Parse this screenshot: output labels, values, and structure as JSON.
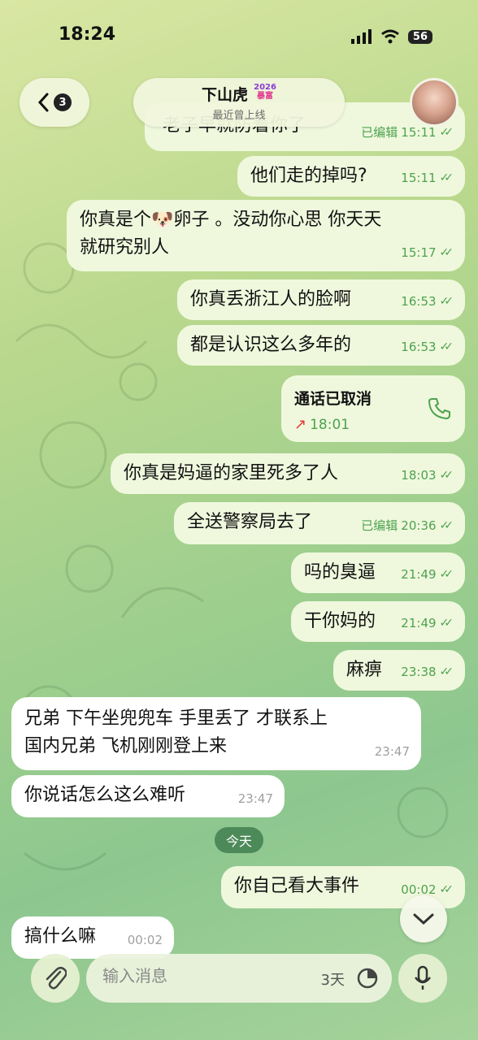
{
  "status_bar": {
    "time": "18:24",
    "battery": "56"
  },
  "header": {
    "unread_count": "3",
    "chat_name": "下山虎",
    "name_tag_line1": "2026",
    "name_tag_line2": "暴富",
    "last_seen": "最近曾上线"
  },
  "messages": [
    {
      "text": "老子早就防着你了",
      "time": "15:11",
      "edited": "已编辑",
      "dir": "out"
    },
    {
      "text": "他们走的掉吗?",
      "time": "15:11",
      "dir": "out"
    },
    {
      "line1_a": "你真是个",
      "emoji": "🐶",
      "line1_b": "卵子 。没动你心思 你天天",
      "line2": "就研究别人",
      "time": "15:17",
      "dir": "out"
    },
    {
      "text": "你真丢浙江人的脸啊",
      "time": "16:53",
      "dir": "out"
    },
    {
      "text": "都是认识这么多年的",
      "time": "16:53",
      "dir": "out"
    },
    {
      "call_title": "通话已取消",
      "call_time": "18:01",
      "dir": "out"
    },
    {
      "text": "你真是妈逼的家里死多了人",
      "time": "18:03",
      "dir": "out"
    },
    {
      "text": "全送警察局去了",
      "time": "20:36",
      "edited": "已编辑",
      "dir": "out"
    },
    {
      "text": "吗的臭逼",
      "time": "21:49",
      "dir": "out"
    },
    {
      "text": "干你妈的",
      "time": "21:49",
      "dir": "out"
    },
    {
      "text": "麻痹",
      "time": "23:38",
      "dir": "out"
    },
    {
      "line1": "兄弟  下午坐兜兜车 手里丢了 才联系上",
      "line2": "国内兄弟  飞机刚刚登上来",
      "time": "23:47",
      "dir": "in"
    },
    {
      "text": "你说话怎么这么难听",
      "time": "23:47",
      "dir": "in"
    },
    {
      "text": "你自己看大事件",
      "time": "00:02",
      "dir": "out"
    },
    {
      "text": "搞什么嘛",
      "time": "00:02",
      "dir": "in"
    }
  ],
  "date_divider": "今天",
  "input": {
    "placeholder": "输入消息",
    "timer": "3天"
  },
  "colors": {
    "outgoing_bubble": "#eff8dd",
    "incoming_bubble": "#ffffff",
    "accent_green": "#4ea24f",
    "date_chip": "#4d8a5a"
  }
}
